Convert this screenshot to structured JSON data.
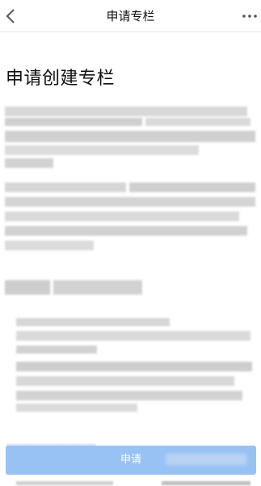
{
  "nav": {
    "title": "申请专栏",
    "back_icon": "chevron-left-icon",
    "more_icon": "more-dots-icon"
  },
  "page": {
    "heading": "申请创建专栏"
  },
  "footer": {
    "apply_label": "申请"
  },
  "colors": {
    "button": "#98c2f4",
    "blur_gray": "#d3d3d3",
    "divider": "#e6e6e6"
  }
}
